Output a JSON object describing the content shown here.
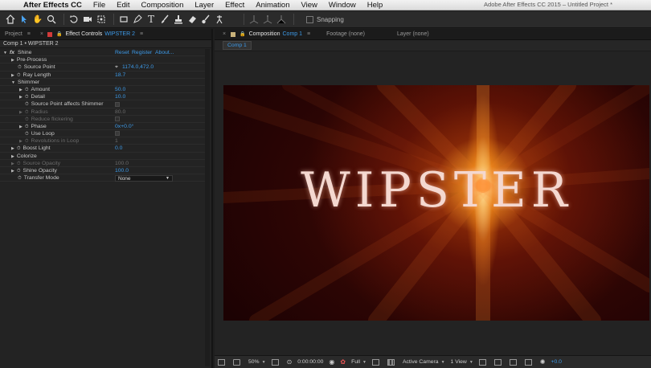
{
  "menubar": {
    "app": "After Effects CC",
    "items": [
      "File",
      "Edit",
      "Composition",
      "Layer",
      "Effect",
      "Animation",
      "View",
      "Window",
      "Help"
    ],
    "window_title": "Adobe After Effects CC 2015 – Untitled Project *"
  },
  "toolbar": {
    "snapping_label": "Snapping"
  },
  "left_panel": {
    "tab_project": "Project",
    "tab_effect_controls": "Effect Controls",
    "tab_effect_controls_layer": "WIPSTER 2",
    "header": "Comp 1 • WIPSTER 2",
    "effect": {
      "name": "Shine",
      "reset": "Reset",
      "register": "Register",
      "about": "About..."
    },
    "properties": [
      {
        "label": "Pre-Process",
        "value": ""
      },
      {
        "label": "Source Point",
        "value": "1174.0,472.0"
      },
      {
        "label": "Ray Length",
        "value": "18.7"
      },
      {
        "label": "Shimmer",
        "value": ""
      },
      {
        "label": "Amount",
        "value": "50.0"
      },
      {
        "label": "Detail",
        "value": "10.0"
      },
      {
        "label": "Source Point affects Shimmer",
        "value": ""
      },
      {
        "label": "Radius",
        "value": "80.0"
      },
      {
        "label": "Reduce flickering",
        "value": ""
      },
      {
        "label": "Phase",
        "value": "0x+0.0°"
      },
      {
        "label": "Use Loop",
        "value": ""
      },
      {
        "label": "Revolutions in Loop",
        "value": "1"
      },
      {
        "label": "Boost Light",
        "value": "0.0"
      },
      {
        "label": "Colorize",
        "value": ""
      },
      {
        "label": "Source Opacity",
        "value": "100.0"
      },
      {
        "label": "Shine Opacity",
        "value": "100.0"
      },
      {
        "label": "Transfer Mode",
        "value": "None"
      }
    ]
  },
  "right_panel": {
    "tab_composition": "Composition",
    "tab_composition_name": "Comp 1",
    "tab_footage": "Footage (none)",
    "tab_layer": "Layer (none)",
    "breadcrumb": "Comp 1",
    "viewer_text": "WIPSTER",
    "viewer_bar": {
      "zoom": "50%",
      "timecode": "0:00:00:00",
      "resolution": "Full",
      "camera": "Active Camera",
      "views": "1 View",
      "exposure": "+0.0"
    }
  }
}
